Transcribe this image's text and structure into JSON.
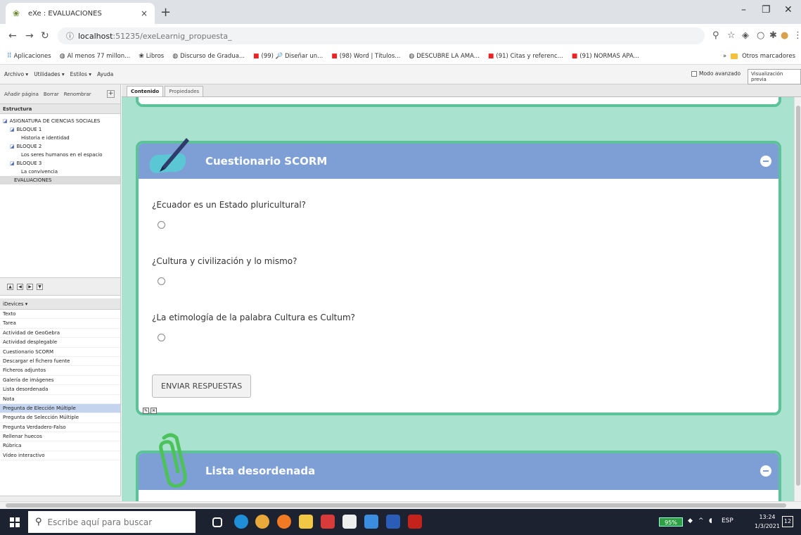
{
  "browser": {
    "tab_title": "eXe : EVALUACIONES",
    "tab_close": "×",
    "new_tab": "+",
    "url_host": "localhost",
    "url_path": ":51235/exeLearnig_propuesta_",
    "bookmarks": [
      {
        "label": "Aplicaciones",
        "icon": "apps"
      },
      {
        "label": "Al menos 77 millon...",
        "icon": "globe"
      },
      {
        "label": "Libros",
        "icon": "exe"
      },
      {
        "label": "Discurso de Gradua...",
        "icon": "globe"
      },
      {
        "label": "(99) 🔎 Diseñar un...",
        "icon": "youtube"
      },
      {
        "label": "(98) Word | Títulos...",
        "icon": "youtube"
      },
      {
        "label": "DESCUBRE LA AMA...",
        "icon": "globe"
      },
      {
        "label": "(91) Citas y referenc...",
        "icon": "youtube"
      },
      {
        "label": "(91) NORMAS APA...",
        "icon": "youtube"
      }
    ],
    "bookmarks_more": "»",
    "other_bookmarks": "Otros marcadores"
  },
  "exe": {
    "menu": [
      "Archivo ▾",
      "Utilidades ▾",
      "Estilos ▾",
      "Ayuda"
    ],
    "advanced_mode": "Modo avanzado",
    "preview": "Visualización previa"
  },
  "left_panel": {
    "toolbar": [
      "Añadir página",
      "Borrar",
      "Renombrar"
    ],
    "structure_header": "Estructura",
    "tree": [
      {
        "label": "ASIGNATURA DE CIENCIAS SOCIALES",
        "level": 0,
        "icon": true
      },
      {
        "label": "BLOQUE 1",
        "level": 1,
        "icon": true
      },
      {
        "label": "Historia e identidad",
        "level": 2,
        "icon": false
      },
      {
        "label": "BLOQUE 2",
        "level": 1,
        "icon": true
      },
      {
        "label": "Los seres humanos en el espacio",
        "level": 2,
        "icon": false
      },
      {
        "label": "BLOQUE 3",
        "level": 1,
        "icon": true
      },
      {
        "label": "La convivencia",
        "level": 2,
        "icon": false
      },
      {
        "label": "EVALUACIONES",
        "level": 1,
        "icon": false
      }
    ],
    "idevices_header": "iDevices ▾",
    "idevices": [
      "Texto",
      "Tarea",
      "Actividad de GeoGebra",
      "Actividad desplegable",
      "Cuestionario SCORM",
      "Descargar el fichero fuente",
      "Ficheros adjuntos",
      "Galería de imágenes",
      "Lista desordenada",
      "Nota",
      "Pregunta de Elección Múltiple",
      "Pregunta de Selección Múltiple",
      "Pregunta Verdadero-Falso",
      "Rellenar huecos",
      "Rúbrica",
      "Vídeo interactivo"
    ]
  },
  "main_tabs": [
    "Contenido",
    "Propiedades"
  ],
  "quiz": {
    "title": "Cuestionario SCORM",
    "questions": [
      "¿Ecuador es un Estado pluricultural?",
      "¿Cultura y civilización y lo mismo?",
      "¿La etimología de la palabra Cultura  es Cultum?"
    ],
    "submit": "ENVIAR RESPUESTAS"
  },
  "list_idevice": {
    "title": "Lista desordenada"
  },
  "taskbar": {
    "search_placeholder": "Escribe aquí para buscar",
    "battery": "95%",
    "language": "ESP",
    "time": "13:24",
    "date": "1/3/2021",
    "notifications": "12"
  }
}
